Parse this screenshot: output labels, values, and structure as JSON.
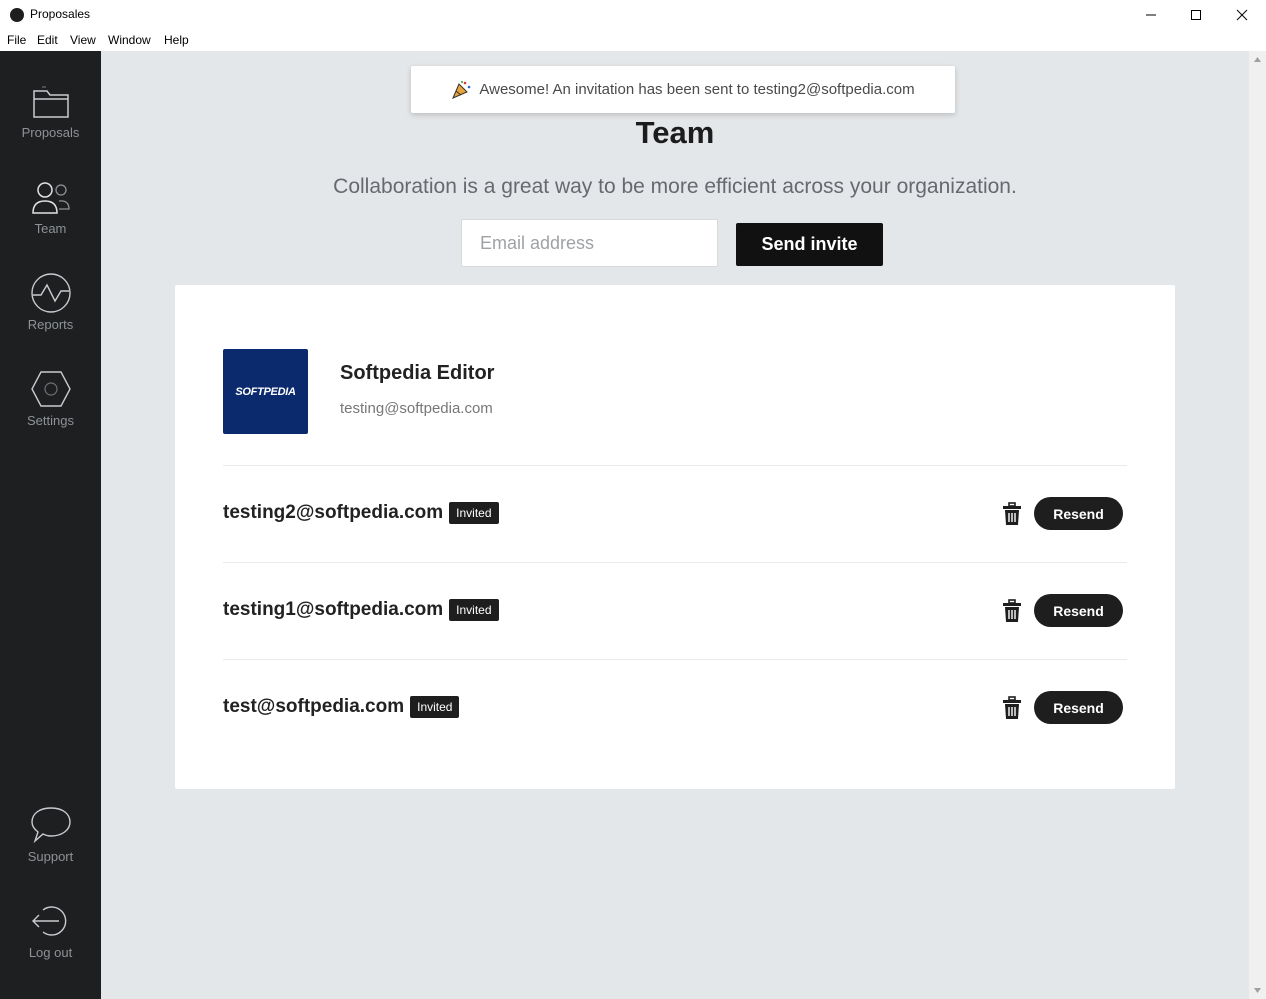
{
  "window": {
    "title": "Proposales"
  },
  "menu": [
    "File",
    "Edit",
    "View",
    "Window",
    "Help"
  ],
  "sidebar": {
    "items": [
      {
        "label": "Proposals",
        "icon": "folder-icon"
      },
      {
        "label": "Team",
        "icon": "users-icon"
      },
      {
        "label": "Reports",
        "icon": "pulse-icon"
      },
      {
        "label": "Settings",
        "icon": "hexagon-icon"
      }
    ],
    "bottom": [
      {
        "label": "Support",
        "icon": "chat-bubble-icon"
      },
      {
        "label": "Log out",
        "icon": "logout-icon"
      }
    ]
  },
  "toast": {
    "text": "Awesome! An invitation has been sent to testing2@softpedia.com",
    "icon": "party-popper-icon"
  },
  "page": {
    "title": "Team",
    "subtitle": "Collaboration is a great way to be more efficient across your organization.",
    "email_placeholder": "Email address",
    "send_label": "Send invite"
  },
  "owner": {
    "name": "Softpedia Editor",
    "email": "testing@softpedia.com",
    "logo_text": "SOFTPEDIA"
  },
  "invites": [
    {
      "email": "testing2@softpedia.com",
      "status": "Invited",
      "resend": "Resend"
    },
    {
      "email": "testing1@softpedia.com",
      "status": "Invited",
      "resend": "Resend"
    },
    {
      "email": "test@softpedia.com",
      "status": "Invited",
      "resend": "Resend"
    }
  ],
  "colors": {
    "sidebar": "#1e1f21",
    "main_bg": "#e4e7e9",
    "accent": "#1e1e1e",
    "avatar": "#0b2a6e"
  }
}
